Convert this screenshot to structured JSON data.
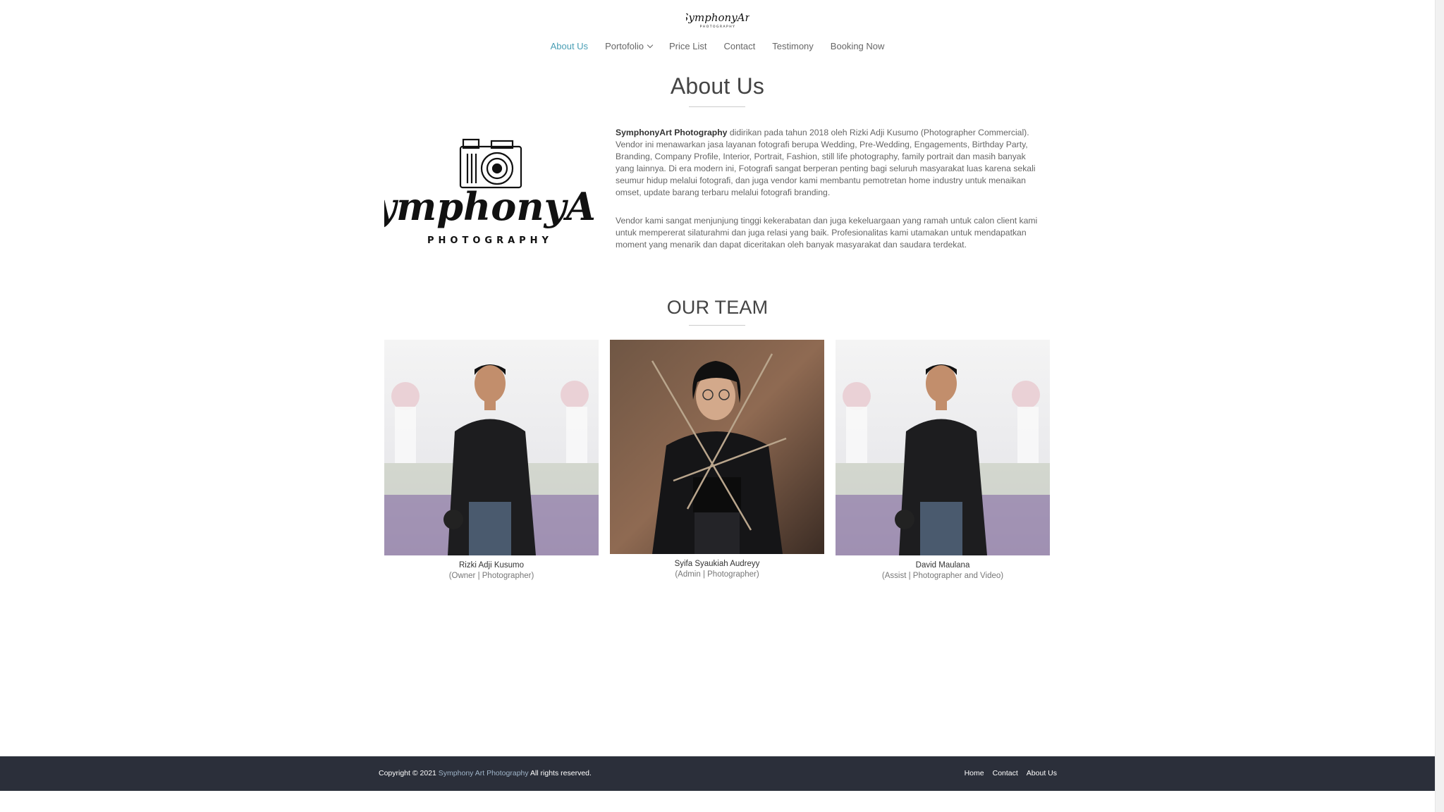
{
  "brand": {
    "logo_text": "SymphonyArt",
    "logo_subtext": "PHOTOGRAPHY"
  },
  "nav": {
    "items": [
      {
        "label": "About Us",
        "active": true
      },
      {
        "label": "Portofolio",
        "has_dropdown": true
      },
      {
        "label": "Price List"
      },
      {
        "label": "Contact"
      },
      {
        "label": "Testimony"
      },
      {
        "label": "Booking Now"
      }
    ]
  },
  "about": {
    "title": "About Us",
    "logo_script": "SymphonyArt",
    "logo_sub": "PHOTOGRAPHY",
    "company_name": "SymphonyArt Photography",
    "paragraph1_rest": " didirikan pada tahun 2018 oleh Rizki Adji Kusumo (Photographer Commercial). Vendor ini menawarkan jasa layanan fotografi berupa Wedding, Pre-Wedding, Engagements, Birthday Party, Branding, Company Profile, Interior, Portrait, Fashion, still life photography, family portrait dan masih banyak yang lainnya. Di era modern ini, Fotografi sangat berperan penting bagi seluruh masyarakat luas karena sekali seumur hidup melalui fotografi, dan juga vendor kami membantu pemotretan home industry untuk menaikan omset, update barang terbaru melalui fotografi branding.",
    "paragraph2": "Vendor kami sangat menjunjung tinggi kekerabatan dan juga kekeluargaan yang ramah untuk calon client kami untuk mempererat silaturahmi dan juga relasi yang baik. Profesionalitas kami utamakan untuk mendapatkan moment yang menarik dan dapat diceritakan oleh banyak masyarakat dan saudara terdekat."
  },
  "team": {
    "title": "OUR TEAM",
    "members": [
      {
        "name": "Rizki Adji Kusumo",
        "role": "(Owner | Photographer)"
      },
      {
        "name": "Syifa Syaukiah Audreyy",
        "role": "(Admin | Photographer)"
      },
      {
        "name": "David Maulana",
        "role": "(Assist | Photographer and Video)"
      }
    ]
  },
  "footer": {
    "copyright_prefix": "Copyright © 2021 ",
    "copyright_brand": "Symphony Art Photography",
    "copyright_suffix": " All rights reserved.",
    "links": [
      "Home",
      "Contact",
      "About Us"
    ]
  },
  "colors": {
    "accent": "#4a9fb5",
    "footer_bg": "#2b2f3a",
    "text": "#666666"
  }
}
